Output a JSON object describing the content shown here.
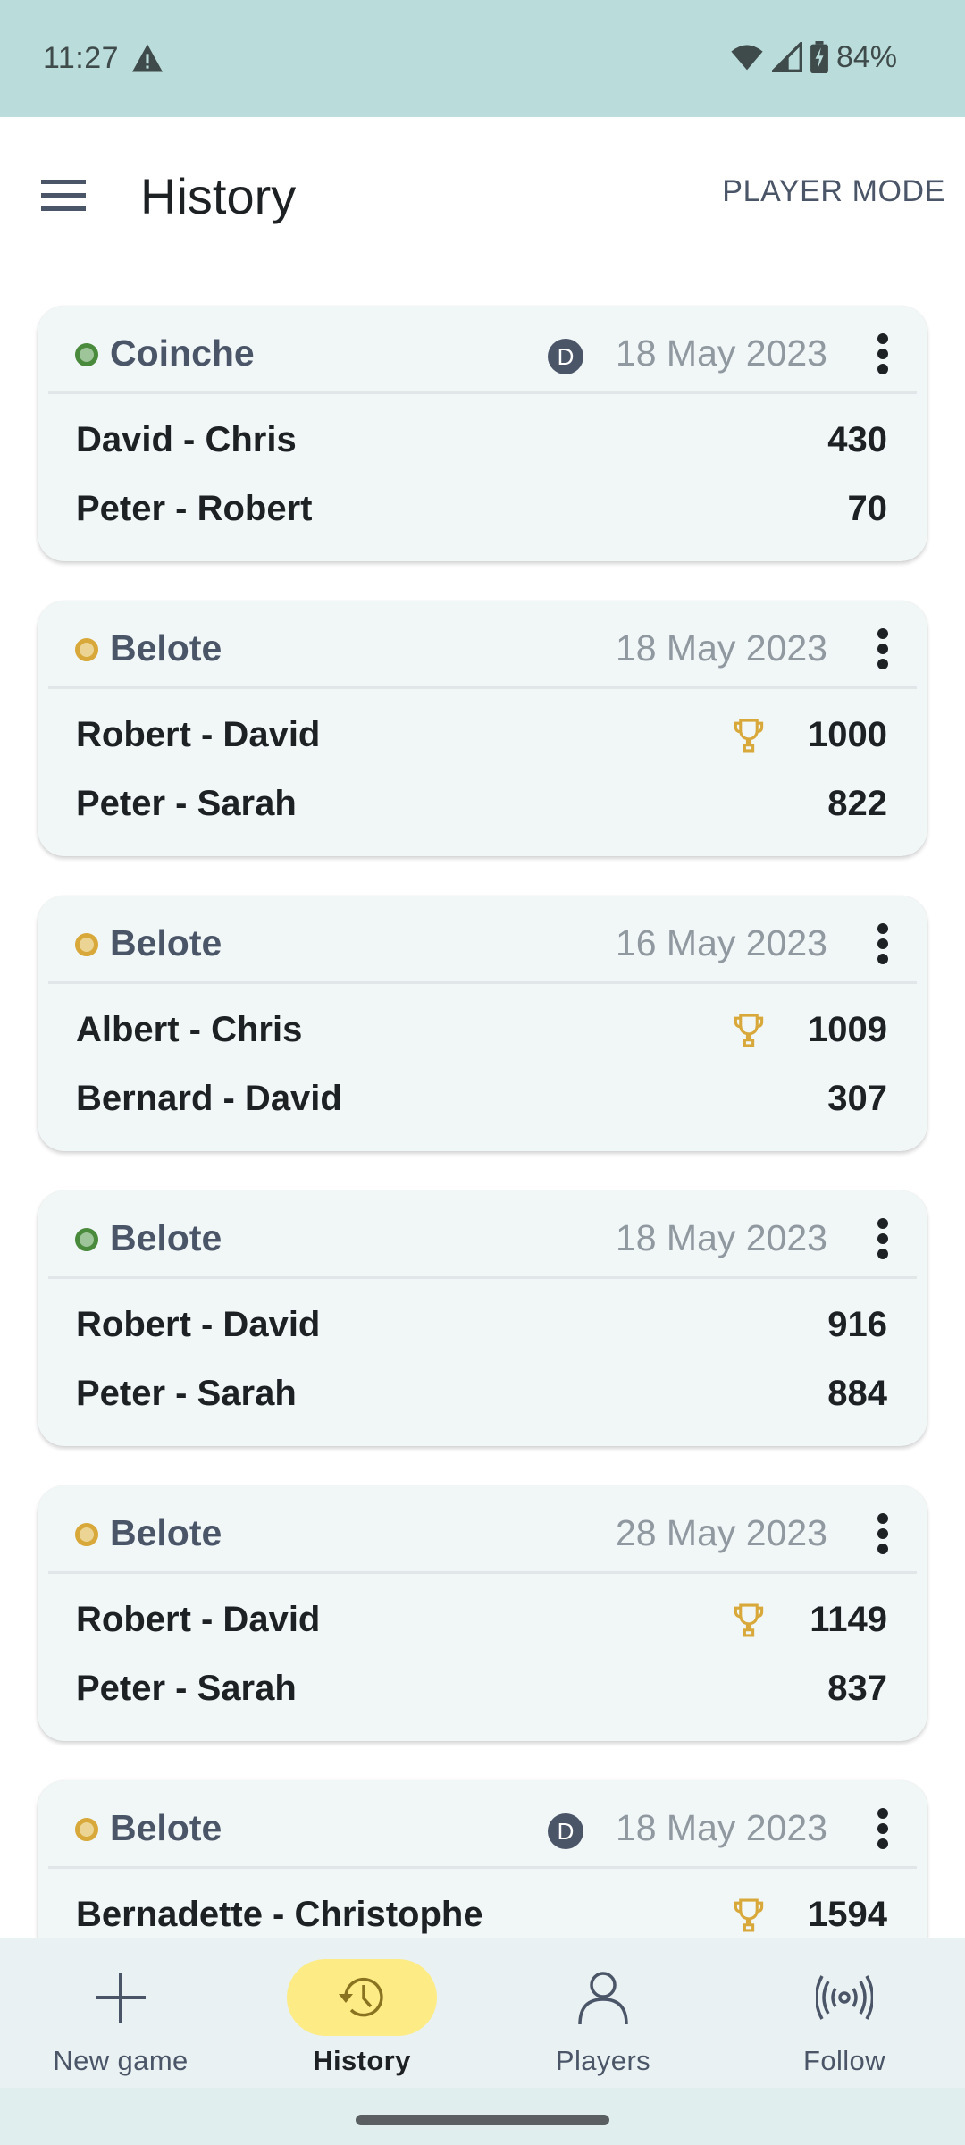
{
  "status_bar": {
    "time": "11:27",
    "battery_percent": "84%",
    "icons": [
      "warning-icon",
      "wifi-icon",
      "cell-signal-icon",
      "battery-charging-icon"
    ]
  },
  "app_bar": {
    "title": "History",
    "menu_icon": "hamburger-menu-icon",
    "mode_button_label": "PLAYER MODE"
  },
  "colors": {
    "status_in_progress": "#4a8a3c",
    "status_finished": "#d8a93a",
    "trophy": "#d8a93a",
    "active_nav_pill": "#fdeb85"
  },
  "games": [
    {
      "name": "Coinche",
      "status": "green",
      "dealer_badge": "D",
      "date": "18 May 2023",
      "teams": [
        {
          "players": "David - Chris",
          "score": "430",
          "winner": false
        },
        {
          "players": "Peter - Robert",
          "score": "70",
          "winner": false
        }
      ]
    },
    {
      "name": "Belote",
      "status": "yellow",
      "dealer_badge": null,
      "date": "18 May 2023",
      "teams": [
        {
          "players": "Robert - David",
          "score": "1000",
          "winner": true
        },
        {
          "players": "Peter - Sarah",
          "score": "822",
          "winner": false
        }
      ]
    },
    {
      "name": "Belote",
      "status": "yellow",
      "dealer_badge": null,
      "date": "16 May 2023",
      "teams": [
        {
          "players": "Albert - Chris",
          "score": "1009",
          "winner": true
        },
        {
          "players": "Bernard - David",
          "score": "307",
          "winner": false
        }
      ]
    },
    {
      "name": "Belote",
      "status": "green",
      "dealer_badge": null,
      "date": "18 May 2023",
      "teams": [
        {
          "players": "Robert - David",
          "score": "916",
          "winner": false
        },
        {
          "players": "Peter - Sarah",
          "score": "884",
          "winner": false
        }
      ]
    },
    {
      "name": "Belote",
      "status": "yellow",
      "dealer_badge": null,
      "date": "28 May 2023",
      "teams": [
        {
          "players": "Robert - David",
          "score": "1149",
          "winner": true
        },
        {
          "players": "Peter - Sarah",
          "score": "837",
          "winner": false
        }
      ]
    },
    {
      "name": "Belote",
      "status": "yellow",
      "dealer_badge": "D",
      "date": "18 May 2023",
      "teams": [
        {
          "players": "Bernadette - Christophe",
          "score": "1594",
          "winner": true
        }
      ]
    }
  ],
  "bottom_nav": {
    "items": [
      {
        "label": "New game",
        "icon": "plus-icon",
        "active": false
      },
      {
        "label": "History",
        "icon": "history-icon",
        "active": true
      },
      {
        "label": "Players",
        "icon": "person-icon",
        "active": false
      },
      {
        "label": "Follow",
        "icon": "broadcast-icon",
        "active": false
      }
    ]
  }
}
